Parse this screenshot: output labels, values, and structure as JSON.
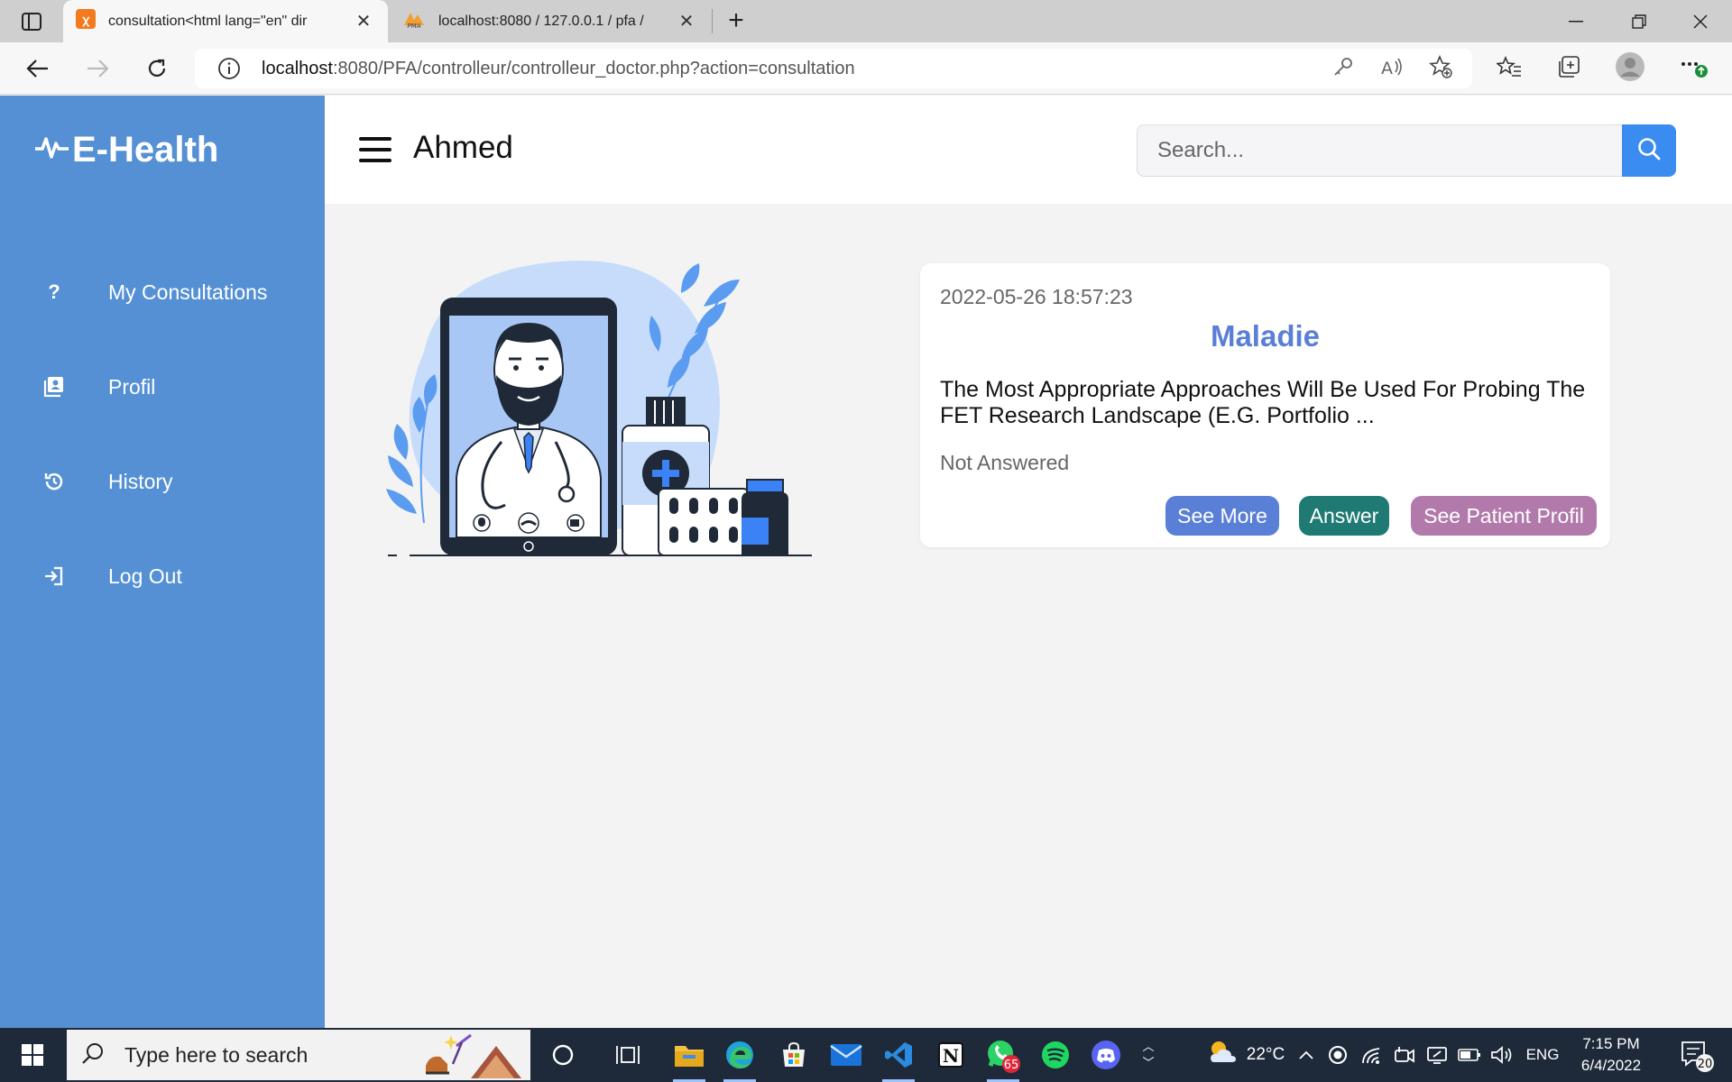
{
  "browser": {
    "tabs": [
      {
        "title": "consultation<html lang=\"en\" dir",
        "active": true
      },
      {
        "title": "localhost:8080 / 127.0.0.1 / pfa /",
        "active": false
      }
    ],
    "url_host": "localhost",
    "url_rest": ":8080/PFA/controlleur/controlleur_doctor.php?action=consultation"
  },
  "sidebar": {
    "brand": "E-Health",
    "items": [
      {
        "label": "My Consultations",
        "icon": "question-icon"
      },
      {
        "label": "Profil",
        "icon": "profile-card-icon"
      },
      {
        "label": "History",
        "icon": "history-icon"
      },
      {
        "label": "Log Out",
        "icon": "logout-icon"
      }
    ]
  },
  "header": {
    "username": "Ahmed",
    "search_placeholder": "Search..."
  },
  "consultation": {
    "date": "2022-05-26 18:57:23",
    "title": "Maladie",
    "description": "The Most Appropriate Approaches Will Be Used For Probing The FET Research Landscape (E.G. Portfolio ...",
    "status": "Not Answered",
    "see_more_label": "See More",
    "answer_label": "Answer",
    "see_patient_label": "See Patient Profil"
  },
  "taskbar": {
    "search_placeholder": "Type here to search",
    "weather": "22°C",
    "language": "ENG",
    "time": "7:15 PM",
    "date": "6/4/2022",
    "whatsapp_badge": "65",
    "notifications_badge": "20"
  },
  "colors": {
    "sidebar": "#5590d4",
    "accent_blue": "#5a7fd6",
    "answer_green": "#1f7a73",
    "profil_pink": "#b27aab",
    "search_button": "#3a8cf0"
  }
}
